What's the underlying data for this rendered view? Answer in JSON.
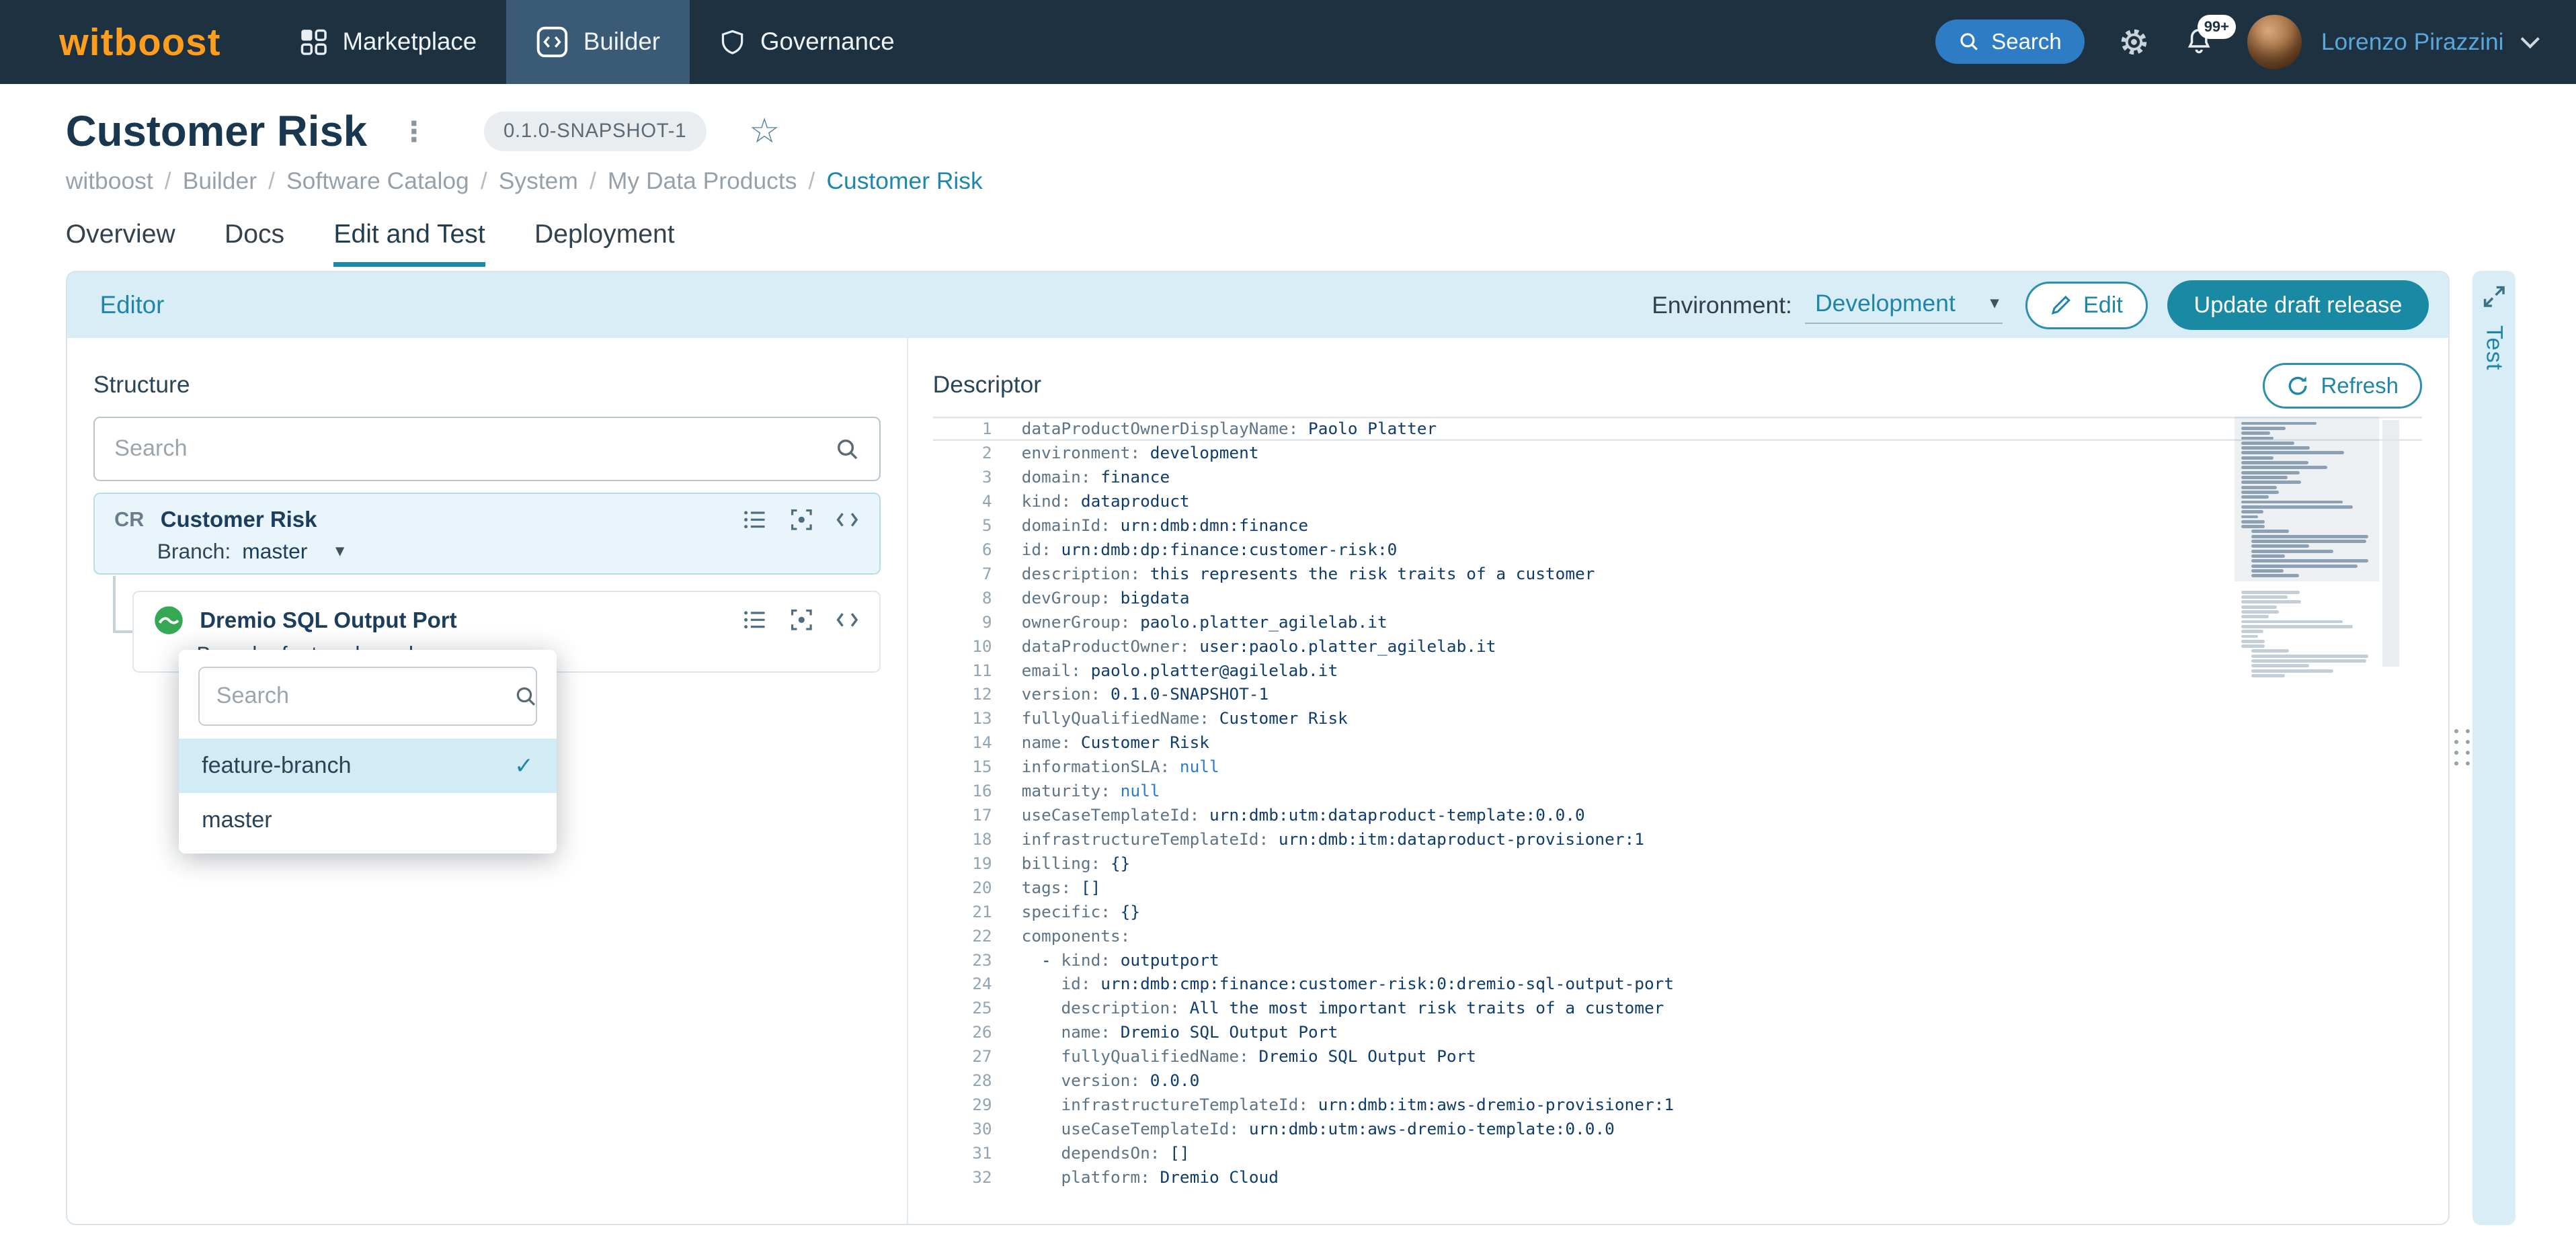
{
  "colors": {
    "navbar_bg": "#1e3141",
    "accent_orange": "#ff9d1c",
    "accent_teal": "#1e87ab",
    "button_teal": "#1a89a4",
    "search_blue": "#2e7cc4",
    "panel_header_bg": "#d8edf6"
  },
  "navbar": {
    "logo_text": "witboost",
    "items": [
      "Marketplace",
      "Builder",
      "Governance"
    ],
    "active_item": "Builder",
    "search_label": "Search",
    "notification_badge": "99+",
    "user_name": "Lorenzo Pirazzini"
  },
  "header": {
    "title": "Customer Risk",
    "version_badge": "0.1.0-SNAPSHOT-1",
    "breadcrumb": [
      "witboost",
      "Builder",
      "Software Catalog",
      "System",
      "My Data Products",
      "Customer Risk"
    ],
    "tabs": [
      "Overview",
      "Docs",
      "Edit and Test",
      "Deployment"
    ],
    "active_tab": "Edit and Test"
  },
  "editor_panel": {
    "title": "Editor",
    "environment_label": "Environment:",
    "environment_value": "Development",
    "edit_button": "Edit",
    "update_button": "Update draft release",
    "test_tab": "Test"
  },
  "structure": {
    "title": "Structure",
    "search_placeholder": "Search",
    "branch_label": "Branch:",
    "parent": {
      "initials": "CR",
      "name": "Customer Risk",
      "branch": "master"
    },
    "child": {
      "name": "Dremio SQL Output Port",
      "branch": "feature-branch"
    },
    "branch_dropdown": {
      "search_placeholder": "Search",
      "options": [
        "feature-branch",
        "master"
      ],
      "selected": "feature-branch"
    }
  },
  "descriptor": {
    "title": "Descriptor",
    "refresh_button": "Refresh",
    "lines": [
      {
        "key": "dataProductOwnerDisplayName",
        "value": "Paolo Platter"
      },
      {
        "key": "environment",
        "value": "development"
      },
      {
        "key": "domain",
        "value": "finance"
      },
      {
        "key": "kind",
        "value": "dataproduct"
      },
      {
        "key": "domainId",
        "value": "urn:dmb:dmn:finance"
      },
      {
        "key": "id",
        "value": "urn:dmb:dp:finance:customer-risk:0"
      },
      {
        "key": "description",
        "value": "this represents the risk traits of a customer"
      },
      {
        "key": "devGroup",
        "value": "bigdata"
      },
      {
        "key": "ownerGroup",
        "value": "paolo.platter_agilelab.it"
      },
      {
        "key": "dataProductOwner",
        "value": "user:paolo.platter_agilelab.it"
      },
      {
        "key": "email",
        "value": "paolo.platter@agilelab.it"
      },
      {
        "key": "version",
        "value": "0.1.0-SNAPSHOT-1"
      },
      {
        "key": "fullyQualifiedName",
        "value": "Customer Risk"
      },
      {
        "key": "name",
        "value": "Customer Risk"
      },
      {
        "key": "informationSLA",
        "value": "null",
        "t": "kw"
      },
      {
        "key": "maturity",
        "value": "null",
        "t": "kw"
      },
      {
        "key": "useCaseTemplateId",
        "value": "urn:dmb:utm:dataproduct-template:0.0.0"
      },
      {
        "key": "infrastructureTemplateId",
        "value": "urn:dmb:itm:dataproduct-provisioner:1"
      },
      {
        "key": "billing",
        "value": "{}"
      },
      {
        "key": "tags",
        "value": "[]"
      },
      {
        "key": "specific",
        "value": "{}"
      },
      {
        "key": "components",
        "value": ""
      },
      {
        "pre": "  - ",
        "key": "kind",
        "value": "outputport"
      },
      {
        "pre": "    ",
        "key": "id",
        "value": "urn:dmb:cmp:finance:customer-risk:0:dremio-sql-output-port"
      },
      {
        "pre": "    ",
        "key": "description",
        "value": "All the most important risk traits of a customer"
      },
      {
        "pre": "    ",
        "key": "name",
        "value": "Dremio SQL Output Port"
      },
      {
        "pre": "    ",
        "key": "fullyQualifiedName",
        "value": "Dremio SQL Output Port"
      },
      {
        "pre": "    ",
        "key": "version",
        "value": "0.0.0"
      },
      {
        "pre": "    ",
        "key": "infrastructureTemplateId",
        "value": "urn:dmb:itm:aws-dremio-provisioner:1"
      },
      {
        "pre": "    ",
        "key": "useCaseTemplateId",
        "value": "urn:dmb:utm:aws-dremio-template:0.0.0"
      },
      {
        "pre": "    ",
        "key": "dependsOn",
        "value": "[]"
      },
      {
        "pre": "    ",
        "key": "platform",
        "value": "Dremio Cloud"
      }
    ]
  }
}
